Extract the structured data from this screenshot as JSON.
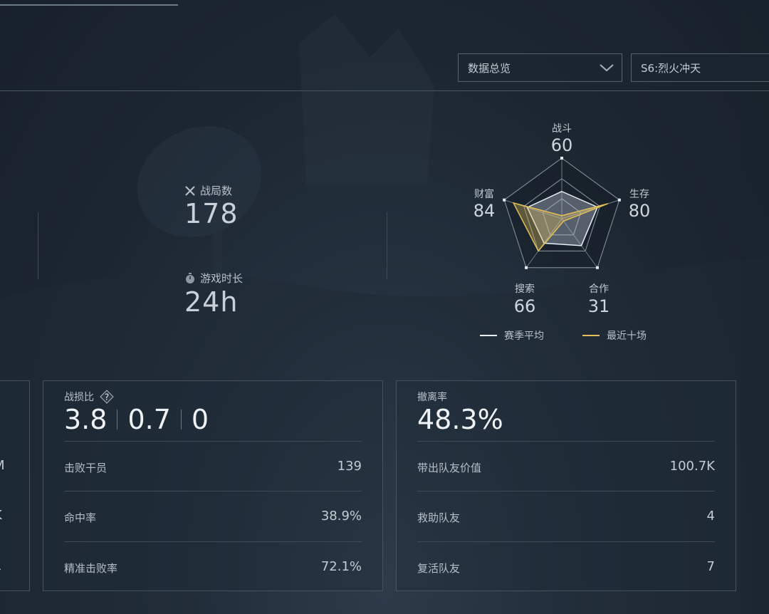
{
  "filters": {
    "view_selected": "数据总览",
    "season_selected": "S6:烈火冲天"
  },
  "summary": {
    "matches_label": "战局数",
    "matches_value": "178",
    "playtime_label": "游戏时长",
    "playtime_value": "24h"
  },
  "radar": {
    "axes": [
      {
        "label": "战斗",
        "value": "60"
      },
      {
        "label": "生存",
        "value": "80"
      },
      {
        "label": "合作",
        "value": "31"
      },
      {
        "label": "搜索",
        "value": "66"
      },
      {
        "label": "财富",
        "value": "84"
      }
    ],
    "season_avg": [
      0.45,
      0.62,
      0.55,
      0.5,
      0.6
    ],
    "recent_ten": [
      0.05,
      0.8,
      0.05,
      0.66,
      0.84
    ],
    "legend_season": "赛季平均",
    "legend_recent": "最近十场",
    "color_season": "#e8eef4",
    "color_recent": "#e2bf5a"
  },
  "left_partial": {
    "values": [
      "M",
      "K",
      "1"
    ]
  },
  "combat_panel": {
    "title": "战损比",
    "help_icon": "?",
    "kd": "3.8",
    "assist": "0.7",
    "deaths": "0",
    "rows": [
      {
        "label": "击败干员",
        "value": "139"
      },
      {
        "label": "命中率",
        "value": "38.9%"
      },
      {
        "label": "精准击败率",
        "value": "72.1%"
      }
    ]
  },
  "extract_panel": {
    "title": "撤离率",
    "rate": "48.3%",
    "rows": [
      {
        "label": "带出队友价值",
        "value": "100.7K"
      },
      {
        "label": "救助队友",
        "value": "4"
      },
      {
        "label": "复活队友",
        "value": "7"
      }
    ]
  }
}
